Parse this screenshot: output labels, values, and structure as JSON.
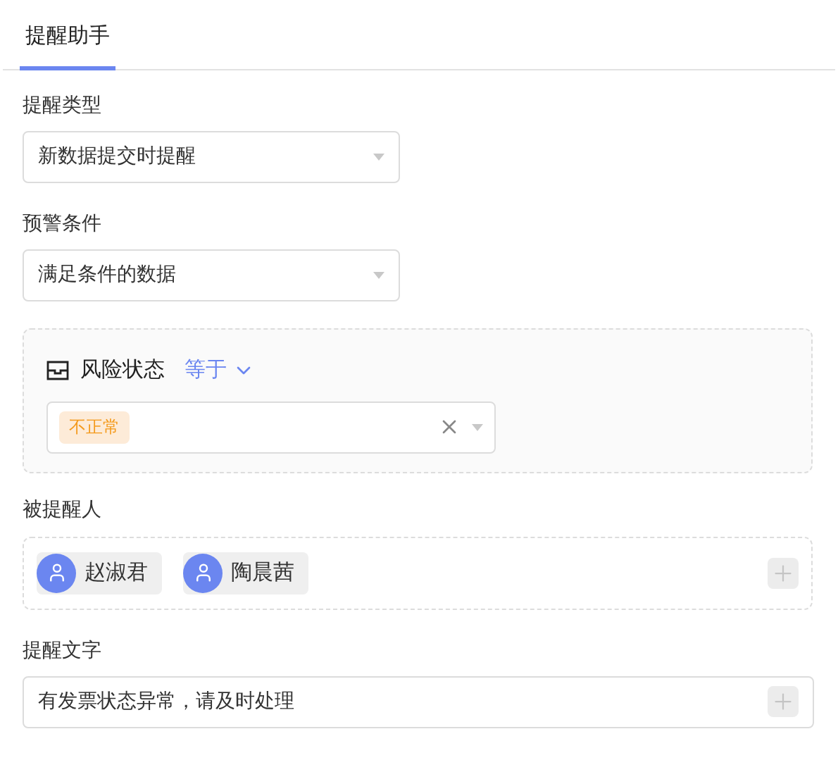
{
  "tabs": [
    {
      "label": "提醒助手",
      "selected": true
    }
  ],
  "reminder_type": {
    "label": "提醒类型",
    "value": "新数据提交时提醒"
  },
  "warning_condition": {
    "label": "预警条件",
    "value": "满足条件的数据"
  },
  "condition": {
    "field": "风险状态",
    "operator": "等于",
    "tags": [
      "不正常"
    ]
  },
  "recipients": {
    "label": "被提醒人",
    "people": [
      "赵淑君",
      "陶晨茜"
    ]
  },
  "reminder_text": {
    "label": "提醒文字",
    "value": "有发票状态异常，请及时处理"
  }
}
